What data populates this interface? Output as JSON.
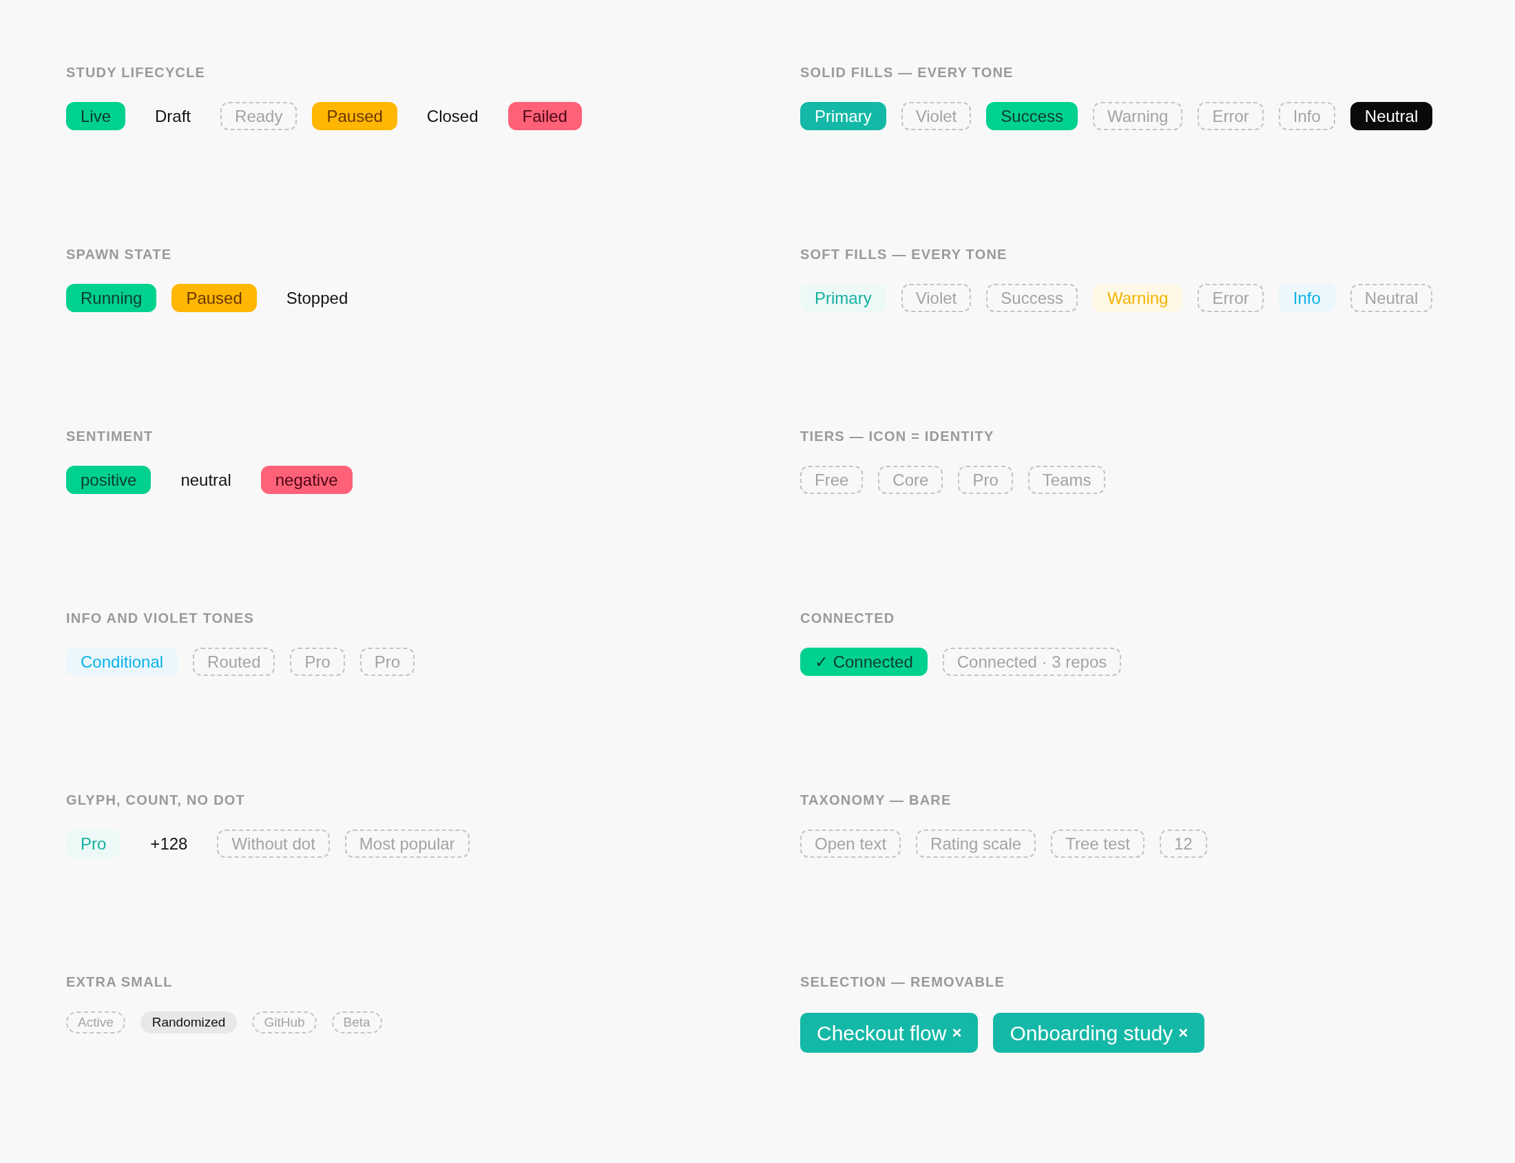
{
  "sections": [
    {
      "title": "STUDY LIFECYCLE",
      "kind": "regular",
      "badges": [
        {
          "label": "Live",
          "kind": "solid-success"
        },
        {
          "label": "Draft",
          "kind": "plain"
        },
        {
          "label": "Ready",
          "kind": "dashed"
        },
        {
          "label": "Paused",
          "kind": "solid-warning"
        },
        {
          "label": "Closed",
          "kind": "plain"
        },
        {
          "label": "Failed",
          "kind": "solid-error"
        }
      ]
    },
    {
      "title": "SOLID FILLS — EVERY TONE",
      "kind": "regular",
      "badges": [
        {
          "label": "Primary",
          "kind": "solid-primary"
        },
        {
          "label": "Violet",
          "kind": "dashed"
        },
        {
          "label": "Success",
          "kind": "solid-success"
        },
        {
          "label": "Warning",
          "kind": "dashed"
        },
        {
          "label": "Error",
          "kind": "dashed"
        },
        {
          "label": "Info",
          "kind": "dashed"
        },
        {
          "label": "Neutral",
          "kind": "solid-neutral"
        }
      ]
    },
    {
      "title": "SPAWN STATE",
      "kind": "regular",
      "badges": [
        {
          "label": "Running",
          "kind": "solid-success"
        },
        {
          "label": "Paused",
          "kind": "solid-warning"
        },
        {
          "label": "Stopped",
          "kind": "plain"
        }
      ]
    },
    {
      "title": "SOFT FILLS — EVERY TONE",
      "kind": "regular",
      "badges": [
        {
          "label": "Primary",
          "kind": "soft-primary"
        },
        {
          "label": "Violet",
          "kind": "dashed"
        },
        {
          "label": "Success",
          "kind": "dashed"
        },
        {
          "label": "Warning",
          "kind": "soft-warning"
        },
        {
          "label": "Error",
          "kind": "dashed"
        },
        {
          "label": "Info",
          "kind": "soft-info"
        },
        {
          "label": "Neutral",
          "kind": "dashed"
        }
      ]
    },
    {
      "title": "SENTIMENT",
      "kind": "regular",
      "badges": [
        {
          "label": "positive",
          "kind": "solid-success"
        },
        {
          "label": "neutral",
          "kind": "plain"
        },
        {
          "label": "negative",
          "kind": "solid-error"
        }
      ]
    },
    {
      "title": "TIERS — ICON = IDENTITY",
      "kind": "regular",
      "badges": [
        {
          "label": "Free",
          "kind": "dashed"
        },
        {
          "label": "Core",
          "kind": "dashed"
        },
        {
          "label": "Pro",
          "kind": "dashed"
        },
        {
          "label": "Teams",
          "kind": "dashed"
        }
      ]
    },
    {
      "title": "INFO AND VIOLET TONES",
      "kind": "regular",
      "badges": [
        {
          "label": "Conditional",
          "kind": "soft-info"
        },
        {
          "label": "Routed",
          "kind": "dashed"
        },
        {
          "label": "Pro",
          "kind": "dashed"
        },
        {
          "label": "Pro",
          "kind": "dashed"
        }
      ]
    },
    {
      "title": "CONNECTED",
      "kind": "regular",
      "badges": [
        {
          "label": "✓ Connected",
          "kind": "solid-success"
        },
        {
          "label": "Connected · 3 repos",
          "kind": "dashed"
        }
      ]
    },
    {
      "title": "GLYPH, COUNT, NO DOT",
      "kind": "regular",
      "badges": [
        {
          "label": "Pro",
          "kind": "soft-primary"
        },
        {
          "label": "+128",
          "kind": "plain"
        },
        {
          "label": "Without dot",
          "kind": "dashed"
        },
        {
          "label": "Most popular",
          "kind": "dashed"
        }
      ]
    },
    {
      "title": "TAXONOMY — BARE",
      "kind": "regular",
      "badges": [
        {
          "label": "Open text",
          "kind": "dashed"
        },
        {
          "label": "Rating scale",
          "kind": "dashed"
        },
        {
          "label": "Tree test",
          "kind": "dashed"
        },
        {
          "label": "12",
          "kind": "dashed"
        }
      ]
    },
    {
      "title": "EXTRA SMALL",
      "kind": "compact",
      "badges": [
        {
          "label": "Active",
          "kind": "dashed"
        },
        {
          "label": "Randomized",
          "kind": "soft-neutral"
        },
        {
          "label": "GitHub",
          "kind": "dashed"
        },
        {
          "label": "Beta",
          "kind": "dashed"
        }
      ]
    },
    {
      "title": "SELECTION — REMOVABLE",
      "kind": "large",
      "badges": [
        {
          "label": "Checkout flow",
          "kind": "removable",
          "remove_glyph": "×"
        },
        {
          "label": "Onboarding study",
          "kind": "removable",
          "remove_glyph": "×"
        }
      ]
    }
  ]
}
